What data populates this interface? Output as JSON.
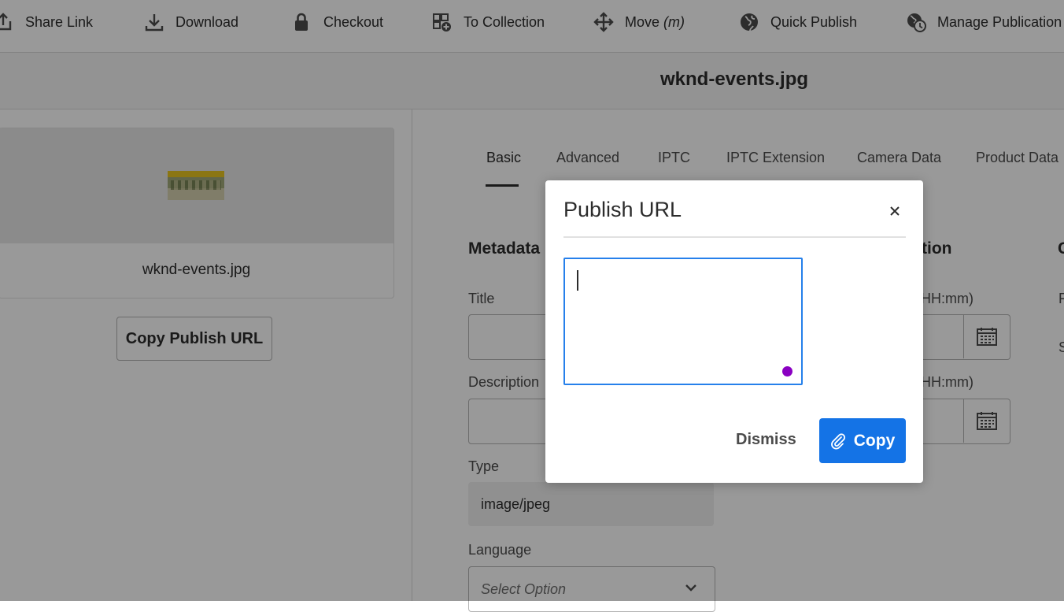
{
  "toolbar": {
    "items": [
      {
        "label": "Share Link",
        "icon": "share-icon"
      },
      {
        "label": "Download",
        "icon": "download-icon"
      },
      {
        "label": "Checkout",
        "icon": "lock-icon"
      },
      {
        "label": "To Collection",
        "icon": "add-to-collection-icon"
      },
      {
        "label": "Move",
        "shortcut": "(m)",
        "icon": "move-icon"
      },
      {
        "label": "Quick Publish",
        "icon": "globe-icon"
      },
      {
        "label": "Manage Publication",
        "icon": "globe-clock-icon"
      }
    ]
  },
  "header": {
    "title": "wknd-events.jpg"
  },
  "asset_card": {
    "name": "wknd-events.jpg"
  },
  "copy_publish_url_button": "Copy Publish URL",
  "tabs": [
    {
      "label": "Basic",
      "active": true
    },
    {
      "label": "Advanced",
      "active": false
    },
    {
      "label": "IPTC",
      "active": false
    },
    {
      "label": "IPTC Extension",
      "active": false
    },
    {
      "label": "Camera Data",
      "active": false
    },
    {
      "label": "Product Data",
      "active": false
    }
  ],
  "form": {
    "section_metadata": "Metadata",
    "section_partial": "tion",
    "title_label": "Title",
    "description_label": "Description",
    "type_label": "Type",
    "type_value": "image/jpeg",
    "language_label": "Language",
    "language_placeholder": "Select Option",
    "date_label_partial_1": "HH:mm)",
    "date_label_partial_2": "HH:mm)"
  },
  "dialog": {
    "title": "Publish URL",
    "textarea_value": "",
    "dismiss_label": "Dismiss",
    "copy_label": "Copy"
  },
  "colors": {
    "accent": "#1473e6",
    "focus_border": "#2680eb",
    "overlay": "rgba(0,0,0,0.4)"
  }
}
